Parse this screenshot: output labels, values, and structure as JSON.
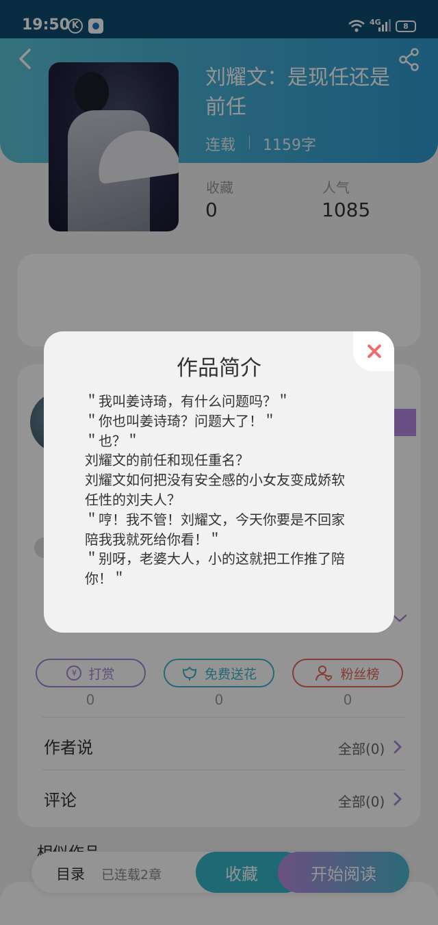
{
  "status": {
    "time": "19:50",
    "k_badge": "K",
    "network": "4G",
    "battery": "8"
  },
  "book": {
    "title": "刘耀文：是现任还是前任",
    "status": "连载",
    "words": "1159字"
  },
  "stats": {
    "favorites_label": "收藏",
    "favorites_value": "0",
    "popularity_label": "人气",
    "popularity_value": "1085"
  },
  "actions": [
    {
      "label": "打赏",
      "count": "0",
      "color": "#a385d2"
    },
    {
      "label": "免费送花",
      "count": "0",
      "color": "#3fb3cb"
    },
    {
      "label": "粉丝榜",
      "count": "0",
      "color": "#e2675b"
    }
  ],
  "sections": {
    "author_says": {
      "label": "作者说",
      "all": "全部(0)"
    },
    "comments": {
      "label": "评论",
      "all": "全部(0)"
    },
    "similar": {
      "label": "相似作品"
    }
  },
  "bottom": {
    "catalog": "目录",
    "chapters": "已连载2章",
    "collect": "收藏",
    "read": "开始阅读"
  },
  "modal": {
    "title": "作品简介",
    "lines": [
      "＂我叫姜诗琦，有什么问题吗？＂",
      "＂你也叫姜诗琦？问题大了！＂",
      "＂也？＂",
      "刘耀文的前任和现任重名？",
      "刘耀文如何把没有安全感的小女友变成娇软任性的刘夫人？",
      "＂哼！我不管！刘耀文，今天你要是不回家陪我我就死给你看！＂",
      "＂别呀，老婆大人，小的这就把工作推了陪你！＂"
    ]
  },
  "colors": {
    "header_start": "#5cc2d6",
    "header_end": "#2f99cf",
    "accent_purple": "#a385d2",
    "close_red": "#ef6b6b"
  }
}
